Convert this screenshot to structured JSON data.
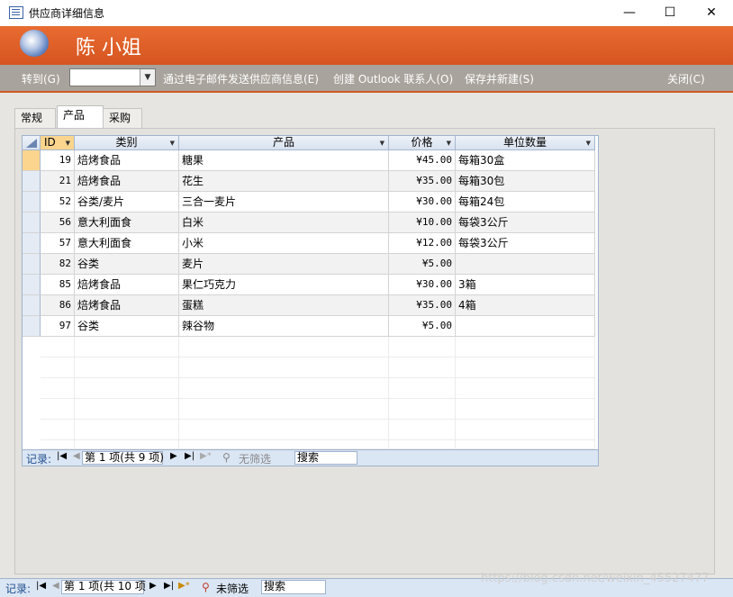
{
  "window": {
    "title": "供应商详细信息",
    "minimize": "—",
    "maximize": "☐",
    "close": "✕"
  },
  "header": {
    "name": "陈 小姐"
  },
  "command_bar": {
    "goto_label": "转到(G)",
    "goto_value": "",
    "email_label": "通过电子邮件发送供应商信息(E)",
    "outlook_label": "创建 Outlook 联系人(O)",
    "save_new_label": "保存并新建(S)",
    "close_label": "关闭(C)"
  },
  "tabs": [
    {
      "label": "常规",
      "active": false
    },
    {
      "label": "产品",
      "active": true
    },
    {
      "label": "采购",
      "active": false
    }
  ],
  "grid": {
    "columns": [
      "ID",
      "类别",
      "产品",
      "价格",
      "单位数量"
    ],
    "rows": [
      {
        "id": "19",
        "category": "焙烤食品",
        "product": "糖果",
        "price": "¥45.00",
        "unit": "每箱30盒"
      },
      {
        "id": "21",
        "category": "焙烤食品",
        "product": "花生",
        "price": "¥35.00",
        "unit": "每箱30包"
      },
      {
        "id": "52",
        "category": "谷类/麦片",
        "product": "三合一麦片",
        "price": "¥30.00",
        "unit": "每箱24包"
      },
      {
        "id": "56",
        "category": "意大利面食",
        "product": "白米",
        "price": "¥10.00",
        "unit": "每袋3公斤"
      },
      {
        "id": "57",
        "category": "意大利面食",
        "product": "小米",
        "price": "¥12.00",
        "unit": "每袋3公斤"
      },
      {
        "id": "82",
        "category": "谷类",
        "product": "麦片",
        "price": "¥5.00",
        "unit": ""
      },
      {
        "id": "85",
        "category": "焙烤食品",
        "product": "果仁巧克力",
        "price": "¥30.00",
        "unit": "3箱"
      },
      {
        "id": "86",
        "category": "焙烤食品",
        "product": "蛋糕",
        "price": "¥35.00",
        "unit": "4箱"
      },
      {
        "id": "97",
        "category": "谷类",
        "product": "辣谷物",
        "price": "¥5.00",
        "unit": ""
      }
    ],
    "nav": {
      "label": "记录:",
      "position": "第 1 项(共 9 项)",
      "filter": "无筛选",
      "search": "搜索"
    }
  },
  "form_nav": {
    "label": "记录:",
    "position": "第 1 项(共 10 项",
    "filter": "未筛选",
    "search": "搜索"
  },
  "watermark": "https://blog.csdn.net/weixin_45527477",
  "colors": {
    "accent": "#e2632a",
    "command_bar": "#a8a39c",
    "nav_bg": "#dbe6f4"
  }
}
